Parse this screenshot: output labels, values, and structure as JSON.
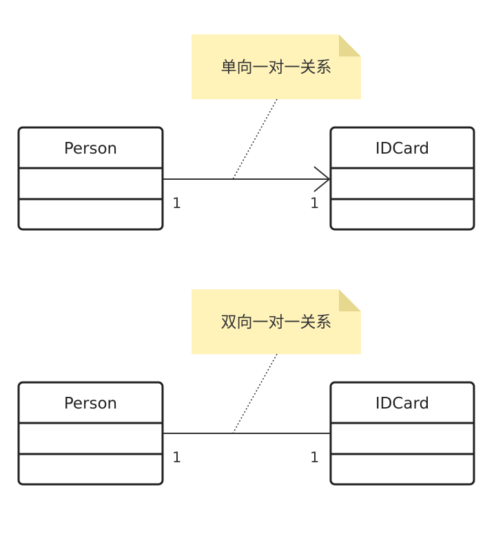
{
  "diagrams": [
    {
      "note": "单向一对一关系",
      "left_class": "Person",
      "right_class": "IDCard",
      "left_multiplicity": "1",
      "right_multiplicity": "1",
      "navigable_arrow": true
    },
    {
      "note": "双向一对一关系",
      "left_class": "Person",
      "right_class": "IDCard",
      "left_multiplicity": "1",
      "right_multiplicity": "1",
      "navigable_arrow": false
    }
  ],
  "colors": {
    "note_fill": "#fff3ba",
    "note_fold": "#e6d88e",
    "class_stroke": "#222222",
    "line": "#333333"
  }
}
